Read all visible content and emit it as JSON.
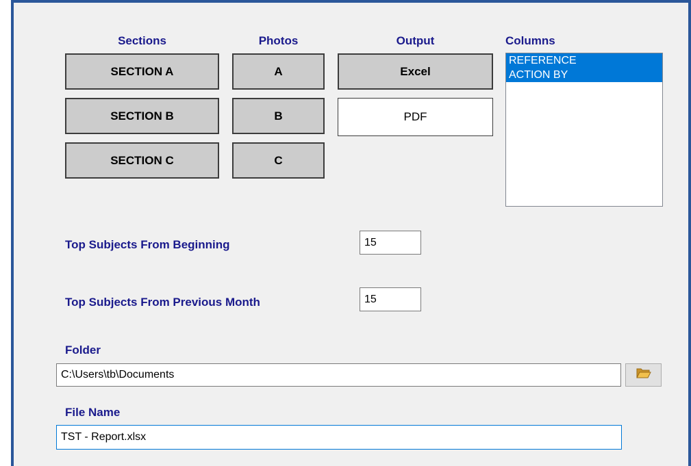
{
  "headers": {
    "sections": "Sections",
    "photos": "Photos",
    "output": "Output",
    "columns": "Columns"
  },
  "sections": [
    {
      "label": "SECTION A",
      "selected": true
    },
    {
      "label": "SECTION B",
      "selected": true
    },
    {
      "label": "SECTION C",
      "selected": true
    }
  ],
  "photos": [
    {
      "label": "A",
      "selected": true
    },
    {
      "label": "B",
      "selected": true
    },
    {
      "label": "C",
      "selected": true
    }
  ],
  "output": [
    {
      "label": "Excel",
      "selected": true
    },
    {
      "label": "PDF",
      "selected": false
    }
  ],
  "columns": {
    "items": [
      {
        "label": "REFERENCE",
        "selected": true
      },
      {
        "label": "ACTION BY",
        "selected": true
      }
    ]
  },
  "top_subjects_beginning": {
    "label": "Top Subjects From Beginning",
    "value": "15"
  },
  "top_subjects_previous_month": {
    "label": "Top Subjects From Previous Month",
    "value": "15"
  },
  "folder": {
    "label": "Folder",
    "value": "C:\\Users\\tb\\Documents",
    "browse_icon": "folder-open-icon"
  },
  "file_name": {
    "label": "File Name",
    "value": "TST - Report.xlsx"
  },
  "colors": {
    "accent": "#0078d7",
    "label_text": "#1a1a8c",
    "window_frame": "#2b579a",
    "toggle_on": "#cccccc",
    "toggle_off": "#ffffff",
    "folder_icon": "#dcaa3c"
  }
}
